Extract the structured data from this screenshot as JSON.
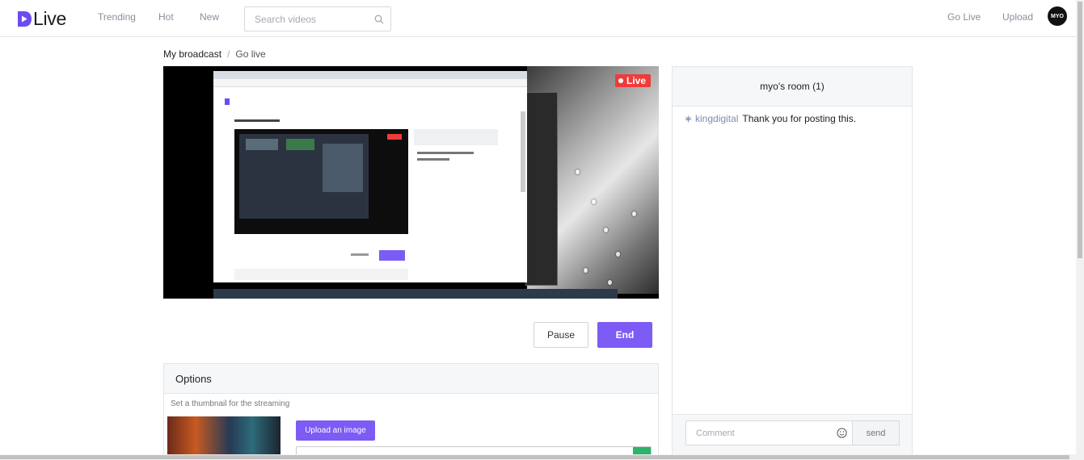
{
  "header": {
    "logo_text": "Live",
    "nav": [
      {
        "label": "Trending"
      },
      {
        "label": "Hot"
      },
      {
        "label": "New"
      }
    ],
    "search_placeholder": "Search videos",
    "right_nav": [
      {
        "label": "Go Live"
      },
      {
        "label": "Upload"
      }
    ],
    "avatar_text": "MYO"
  },
  "breadcrumb": {
    "items": [
      "My broadcast",
      "Go live"
    ],
    "separator": "/"
  },
  "player": {
    "live_label": "Live"
  },
  "controls": {
    "pause_label": "Pause",
    "end_label": "End"
  },
  "options": {
    "title": "Options",
    "subtitle": "Set a thumbnail for the streaming",
    "upload_label": "Upload an image"
  },
  "chat": {
    "room_title": "myo's room (1)",
    "messages": [
      {
        "user": "kingdigital",
        "text": "Thank you for posting this."
      }
    ],
    "comment_placeholder": "Comment",
    "send_label": "send"
  },
  "colors": {
    "accent": "#7c5cf4",
    "live_red": "#ef3b3b",
    "logo_blue": "#6c4cf0",
    "chat_user": "#7d8bb5"
  }
}
